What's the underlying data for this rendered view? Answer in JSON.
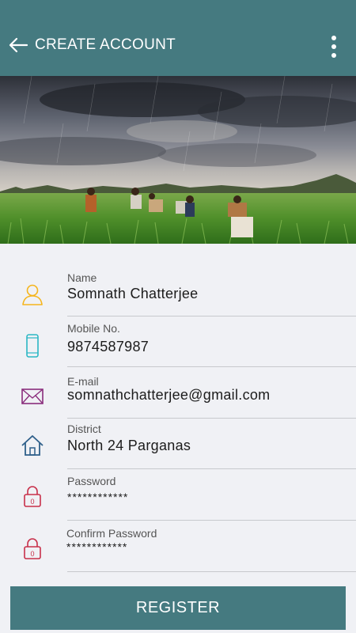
{
  "appbar": {
    "title": "CREATE ACCOUNT",
    "color": "#457a80"
  },
  "banner": {
    "description_icon": "rice-field-rain-photo"
  },
  "form": {
    "name": {
      "label": "Name",
      "value": "Somnath Chatterjee",
      "icon": "user-icon",
      "icon_color": "#f5b51d"
    },
    "mobile": {
      "label": "Mobile No.",
      "value": "9874587987",
      "icon": "phone-icon",
      "icon_color": "#2bb7c4"
    },
    "email": {
      "label": "E-mail",
      "value": "somnathchatterjee@gmail.com",
      "icon": "mail-icon",
      "icon_color": "#8a2d7c"
    },
    "district": {
      "label": "District",
      "value": "North 24 Parganas",
      "icon": "home-icon",
      "icon_color": "#2e5f8a"
    },
    "password": {
      "label": "Password",
      "value": "************",
      "icon": "lock-icon",
      "icon_color": "#c8304a"
    },
    "confirm_password": {
      "label": "Confirm Password",
      "value": "************",
      "icon": "lock-icon",
      "icon_color": "#c8304a"
    }
  },
  "register_button": {
    "label": "REGISTER"
  }
}
